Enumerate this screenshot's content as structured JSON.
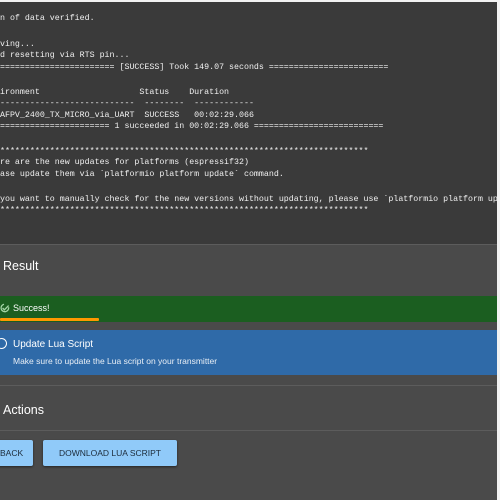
{
  "terminal": {
    "lines": [
      "n of data verified.",
      "",
      "ving...",
      "d resetting via RTS pin...",
      "======================= [SUCCESS] Took 149.07 seconds ========================",
      "",
      "ironment                    Status    Duration",
      "---------------------------  --------  ------------",
      "AFPV_2400_TX_MICRO_via_UART  SUCCESS   00:02:29.066",
      "====================== 1 succeeded in 00:02:29.066 ==========================",
      "",
      "**************************************************************************",
      "re are the new updates for platforms (espressif32)",
      "ase update them via `platformio platform update` command.",
      "",
      "you want to manually check for the new versions without updating, please use `platformio platform update --dry-run` command.",
      "**************************************************************************"
    ]
  },
  "result": {
    "title": "Result",
    "success_text": "Success!",
    "progress": 0.2
  },
  "lua_panel": {
    "title": "Update Lua Script",
    "description": "Make sure to update the Lua script on your transmitter"
  },
  "actions": {
    "title": "Actions",
    "back_label": "BACK",
    "download_label": "DOWNLOAD LUA SCRIPT"
  },
  "colors": {
    "success": "#1b5e20",
    "progress": "#ff9800",
    "info": "#2f6aa8",
    "button": "#90caf9"
  },
  "icons": [
    "check-circle-icon",
    "info-circle-icon"
  ]
}
